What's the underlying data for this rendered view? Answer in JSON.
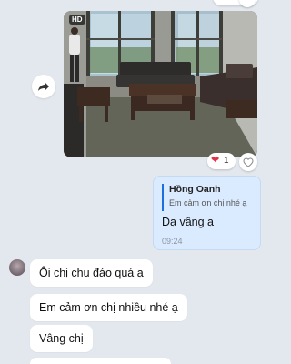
{
  "top_reaction": {
    "count": "1"
  },
  "photo_message": {
    "badge": "HD"
  },
  "reaction": {
    "emoji": "❤",
    "count": "1",
    "add_icon": "heart-outline-icon"
  },
  "reply_message": {
    "quoted_author": "Hồng Oanh",
    "quoted_text": "Em cảm ơn chị nhé ạ",
    "text": "Dạ vâng ạ",
    "time": "09:24"
  },
  "incoming_messages": [
    {
      "text": "Ôi chị chu đáo quá ạ"
    },
    {
      "text": "Em cảm ơn chị nhiều nhé ạ"
    },
    {
      "text": "Vâng chị"
    }
  ],
  "colors": {
    "background": "#e3e8ee",
    "outgoing_bubble": "#dbebff",
    "accent": "#1d6fe0",
    "heart": "#e0334a"
  }
}
